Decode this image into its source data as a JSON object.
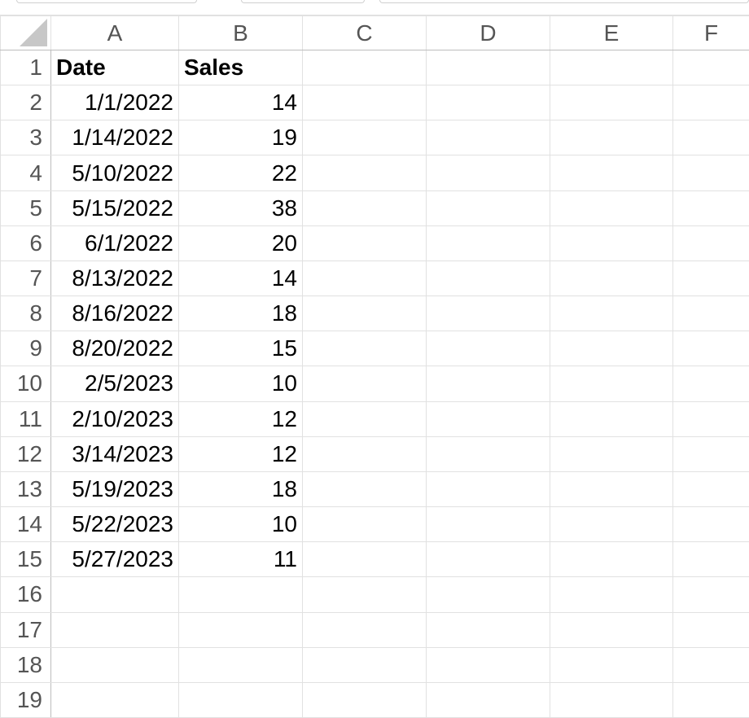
{
  "columns": [
    "A",
    "B",
    "C",
    "D",
    "E",
    "F"
  ],
  "header_row": {
    "num": "1",
    "a": "Date",
    "b": "Sales"
  },
  "rows": [
    {
      "num": "2",
      "date": "1/1/2022",
      "sales": "14"
    },
    {
      "num": "3",
      "date": "1/14/2022",
      "sales": "19"
    },
    {
      "num": "4",
      "date": "5/10/2022",
      "sales": "22"
    },
    {
      "num": "5",
      "date": "5/15/2022",
      "sales": "38"
    },
    {
      "num": "6",
      "date": "6/1/2022",
      "sales": "20"
    },
    {
      "num": "7",
      "date": "8/13/2022",
      "sales": "14"
    },
    {
      "num": "8",
      "date": "8/16/2022",
      "sales": "18"
    },
    {
      "num": "9",
      "date": "8/20/2022",
      "sales": "15"
    },
    {
      "num": "10",
      "date": "2/5/2023",
      "sales": "10"
    },
    {
      "num": "11",
      "date": "2/10/2023",
      "sales": "12"
    },
    {
      "num": "12",
      "date": "3/14/2023",
      "sales": "12"
    },
    {
      "num": "13",
      "date": "5/19/2023",
      "sales": "18"
    },
    {
      "num": "14",
      "date": "5/22/2023",
      "sales": "10"
    },
    {
      "num": "15",
      "date": "5/27/2023",
      "sales": "11"
    }
  ],
  "empty_rows": [
    "16",
    "17",
    "18",
    "19"
  ],
  "colors": {
    "grid_line": "#e1e1e1",
    "header_text": "#555555",
    "select_all_triangle": "#c7c7c7"
  }
}
